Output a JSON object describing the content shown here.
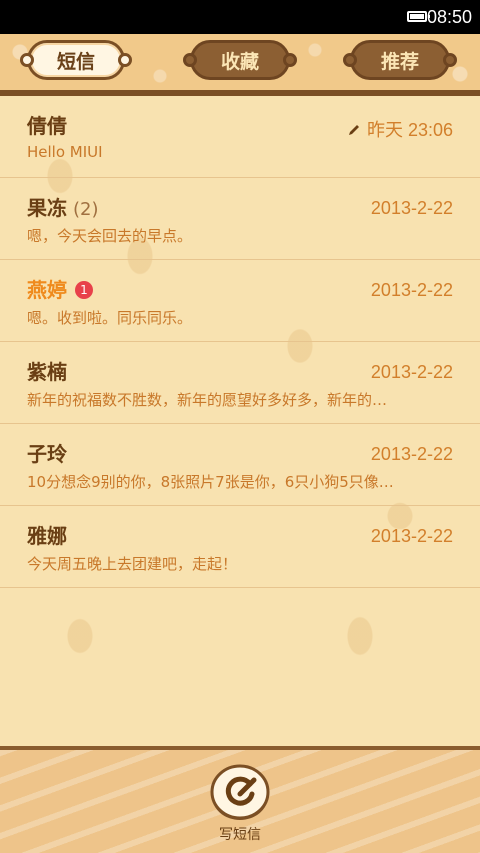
{
  "status_bar": {
    "time": "08:50"
  },
  "tabs": [
    {
      "label": "短信",
      "active": true
    },
    {
      "label": "收藏",
      "active": false
    },
    {
      "label": "推荐",
      "active": false
    }
  ],
  "conversations": [
    {
      "name": "倩倩",
      "count": "",
      "badge": "",
      "date": "昨天 23:06",
      "preview": "Hello MIUI",
      "draft": true,
      "unread": false
    },
    {
      "name": "果冻",
      "count": "(2)",
      "badge": "",
      "date": "2013-2-22",
      "preview": "嗯，今天会回去的早点。",
      "draft": false,
      "unread": false
    },
    {
      "name": "燕婷",
      "count": "",
      "badge": "1",
      "date": "2013-2-22",
      "preview": "嗯。收到啦。同乐同乐。",
      "draft": false,
      "unread": true
    },
    {
      "name": "紫楠",
      "count": "",
      "badge": "",
      "date": "2013-2-22",
      "preview": "新年的祝福数不胜数，新年的愿望好多好多，新年的…",
      "draft": false,
      "unread": false
    },
    {
      "name": "子玲",
      "count": "",
      "badge": "",
      "date": "2013-2-22",
      "preview": "10分想念9别的你，8张照片7张是你，6只小狗5只像…",
      "draft": false,
      "unread": false
    },
    {
      "name": "雅娜",
      "count": "",
      "badge": "",
      "date": "2013-2-22",
      "preview": "今天周五晚上去团建吧，走起！",
      "draft": false,
      "unread": false
    }
  ],
  "compose": {
    "label": "写短信"
  },
  "colors": {
    "accent": "#d27f2b",
    "unread_name": "#ef8a1c",
    "badge": "#e8414a",
    "header_border": "#7b4f24"
  },
  "icons": {
    "battery": "battery-icon",
    "draft": "pencil-icon",
    "compose": "compose-icon"
  }
}
